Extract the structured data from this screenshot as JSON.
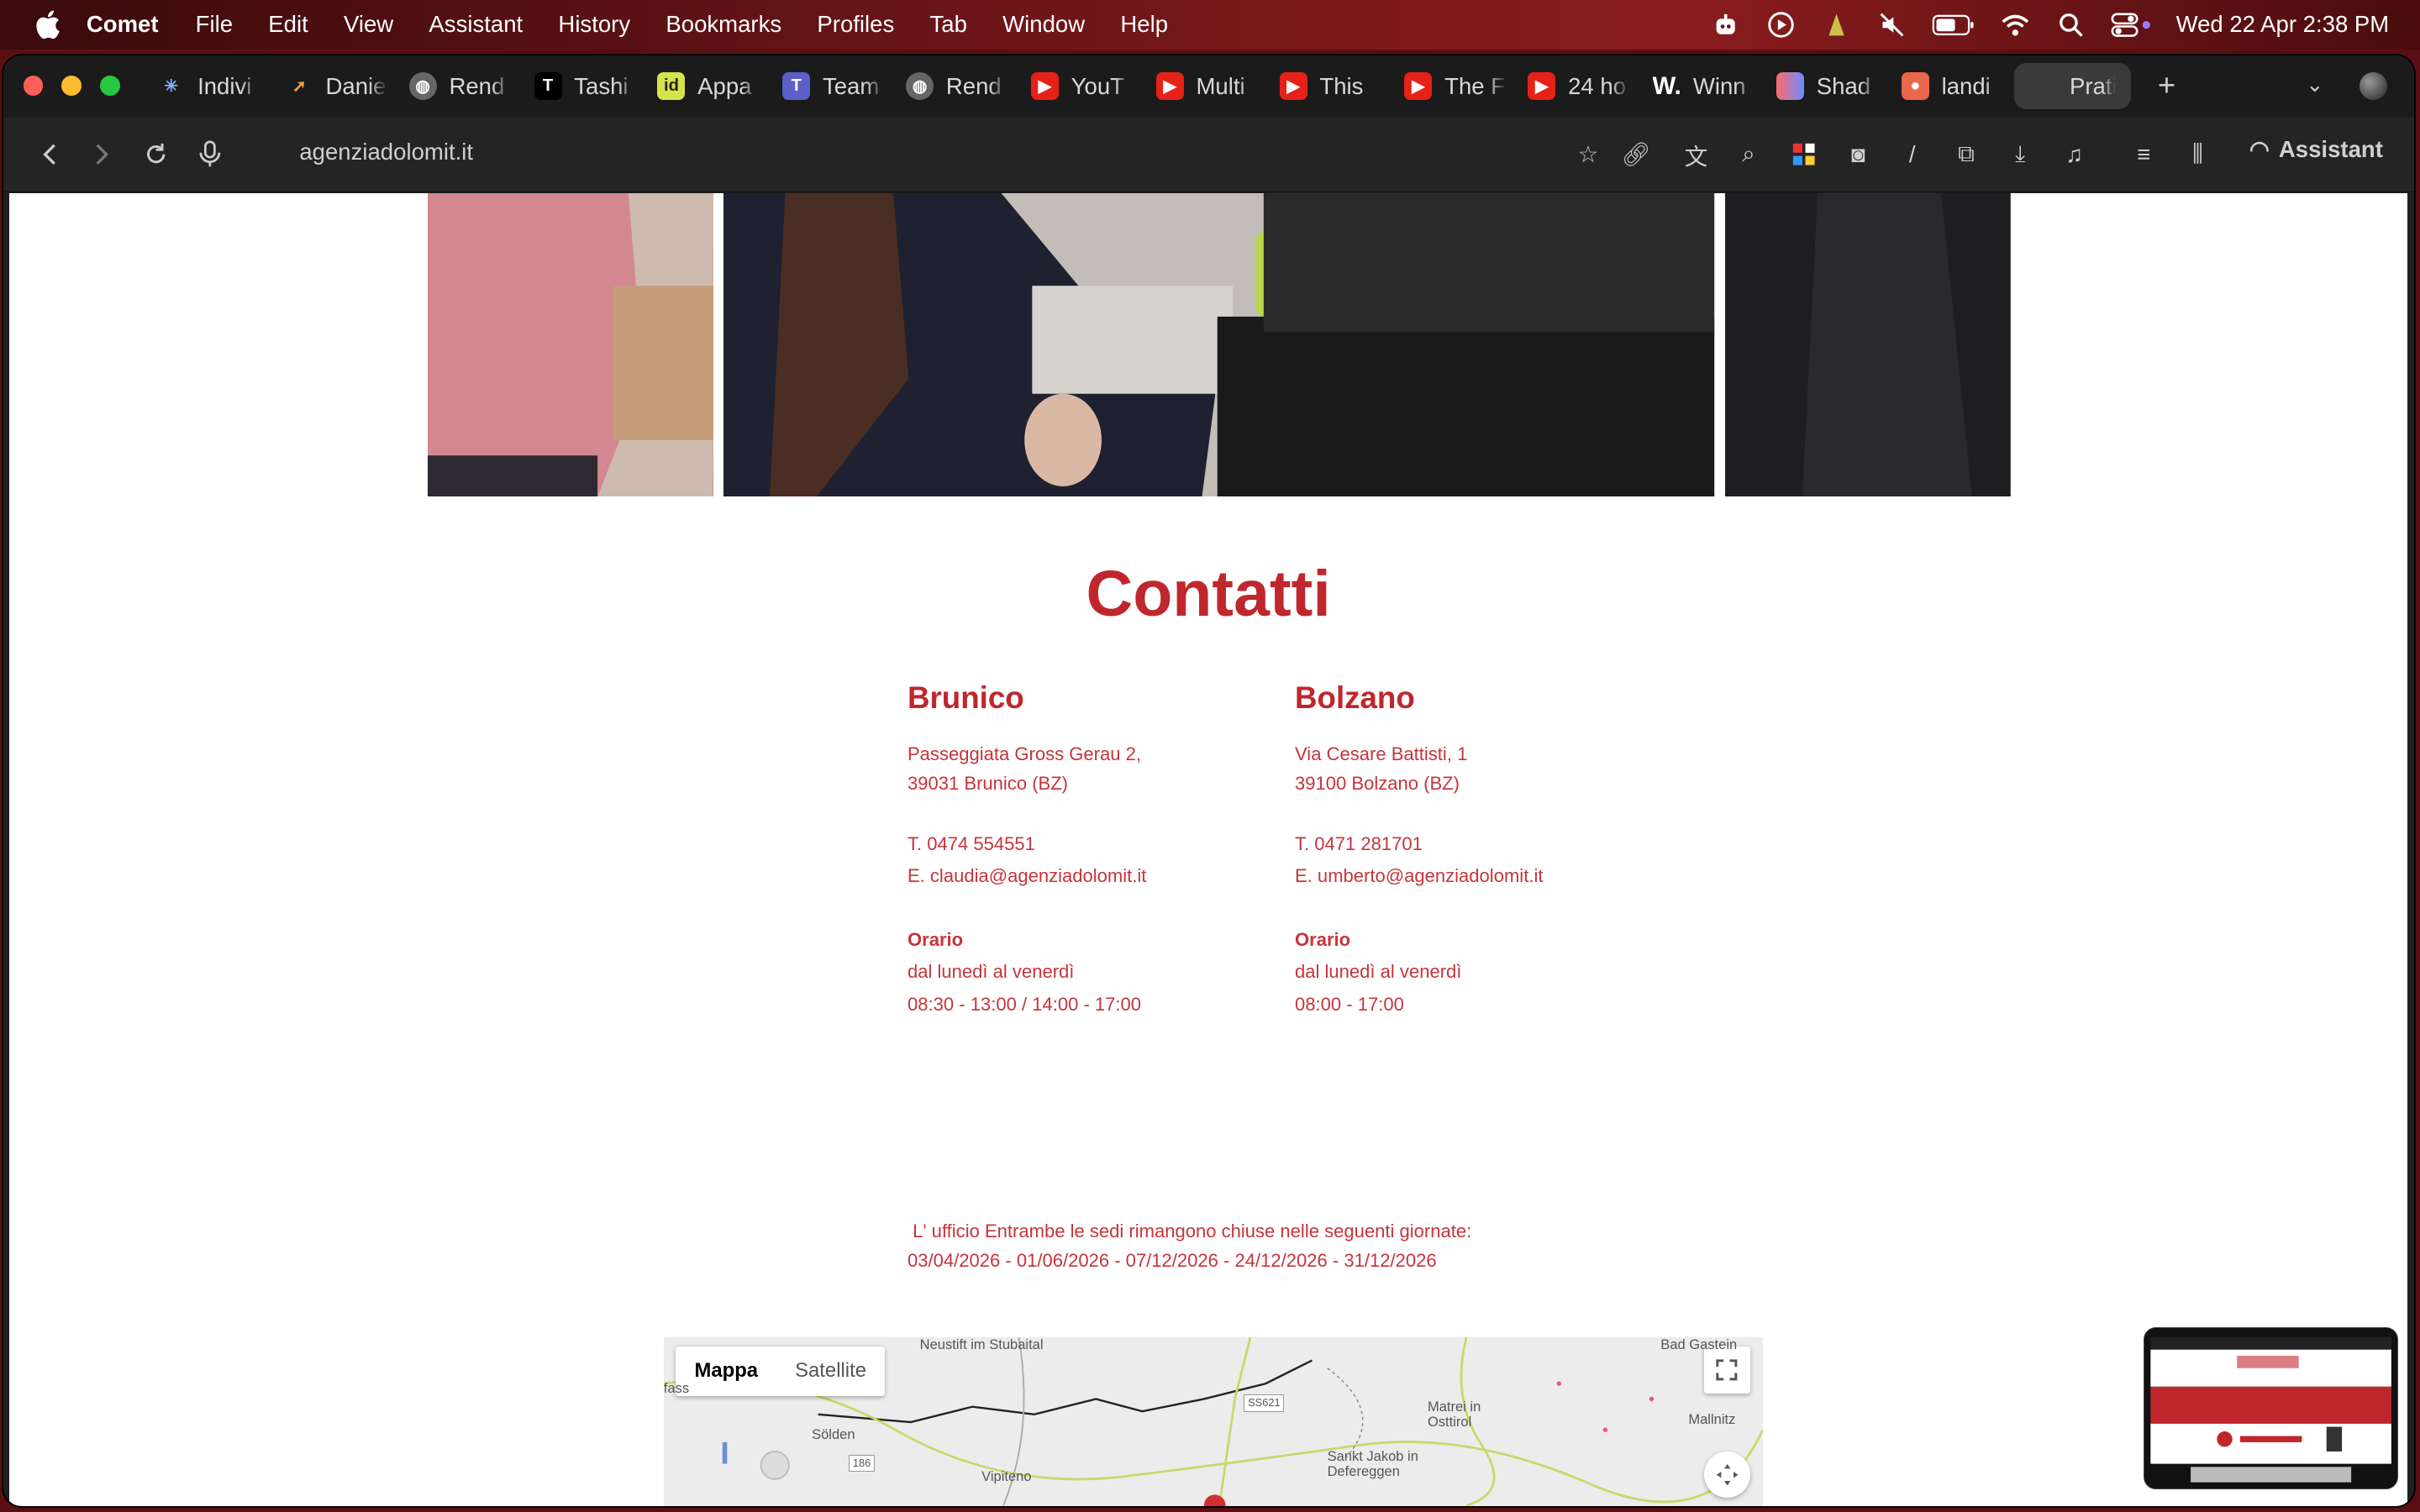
{
  "menubar": {
    "app": "Comet",
    "items": [
      "File",
      "Edit",
      "View",
      "Assistant",
      "History",
      "Bookmarks",
      "Profiles",
      "Tab",
      "Window",
      "Help"
    ],
    "clock": "Wed 22 Apr  2:38 PM"
  },
  "tabs": [
    {
      "label": "Indivi",
      "icon": "sparkle-icon",
      "color": "#444"
    },
    {
      "label": "Danie",
      "icon": "arrow-icon",
      "color": "#333"
    },
    {
      "label": "Rend",
      "icon": "globe-icon",
      "color": "#555"
    },
    {
      "label": "Tashi",
      "icon": "t-icon",
      "color": "#000"
    },
    {
      "label": "Appa",
      "icon": "id-icon",
      "color": "#d7e34a"
    },
    {
      "label": "Team",
      "icon": "teams-icon",
      "color": "#5b5fc7"
    },
    {
      "label": "Rend",
      "icon": "globe-icon",
      "color": "#555"
    },
    {
      "label": "YouT",
      "icon": "youtube-icon",
      "color": "#e62117"
    },
    {
      "label": "Multi",
      "icon": "youtube-icon",
      "color": "#e62117"
    },
    {
      "label": "This",
      "icon": "youtube-icon",
      "color": "#e62117"
    },
    {
      "label": "The F",
      "icon": "youtube-icon",
      "color": "#e62117"
    },
    {
      "label": "24 ho",
      "icon": "youtube-icon",
      "color": "#e62117"
    },
    {
      "label": "Winn",
      "icon": "w-icon",
      "color": "#1b1b1b"
    },
    {
      "label": "Shad",
      "icon": "shadow-icon",
      "color": "#444"
    },
    {
      "label": "landi",
      "icon": "palette-icon",
      "color": "#e9674a"
    },
    {
      "label": "Pratic",
      "icon": "blank-icon",
      "color": "#3a3a3a"
    }
  ],
  "toolbar": {
    "url": "agenziadolomit.it",
    "assistant_label": "Assistant"
  },
  "page": {
    "title": "Contatti",
    "offices": [
      {
        "city": "Brunico",
        "address1": "Passeggiata Gross Gerau 2,",
        "address2": "39031 Brunico (BZ)",
        "phone": "T. 0474 554551",
        "email": "E. claudia@agenziadolomit.it",
        "hours_label": "Orario",
        "days": "dal lunedì al venerdì",
        "hours": "08:30 - 13:00 / 14:00 - 17:00"
      },
      {
        "city": "Bolzano",
        "address1": "Via Cesare Battisti, 1",
        "address2": "39100 Bolzano (BZ)",
        "phone": "T. 0471 281701",
        "email": "E. umberto@agenziadolomit.it",
        "hours_label": "Orario",
        "days": "dal lunedì al venerdì",
        "hours": "08:00 - 17:00"
      }
    ],
    "closure_line1": " L' ufficio Entrambe le sedi rimangono chiuse nelle seguenti giornate:",
    "closure_line2": "03/04/2026 - 01/06/2026 - 07/12/2026 - 24/12/2026 - 31/12/2026"
  },
  "map": {
    "tab_map": "Mappa",
    "tab_satellite": "Satellite",
    "labels": {
      "neustift": "Neustift im Stubaital",
      "badgastein": "Bad Gastein",
      "matrei": "Matrei in Osttirol",
      "mallnitz": "Mallnitz",
      "solden": "Sölden",
      "sanktjakob": "Sankt Jakob in Defereggen",
      "vipiteno": "Vipiteno",
      "ss621": "SS621",
      "road186": "186",
      "fass": "fass"
    }
  },
  "colors": {
    "accent_red": "#c0262d",
    "menubar": "#6b1518"
  }
}
